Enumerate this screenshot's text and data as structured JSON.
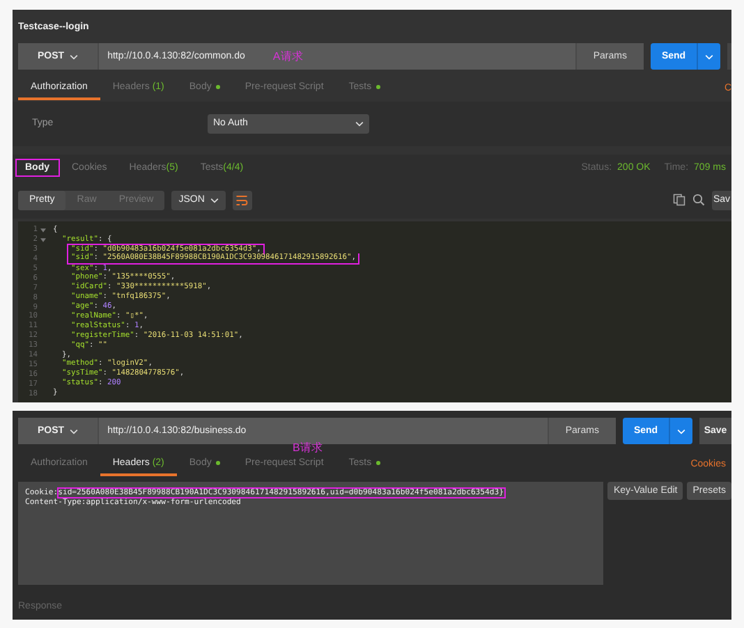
{
  "request_a": {
    "title": "Testcase--login",
    "method": "POST",
    "url": "http://10.0.4.130:82/common.do",
    "note": "A请求",
    "params_button": "Params",
    "send_button": "Send",
    "cookies_link": "C",
    "tabs": [
      {
        "label": "Authorization",
        "selected": true
      },
      {
        "label": "Headers",
        "count": "(1)",
        "selected": false
      },
      {
        "label": "Body",
        "dot": true,
        "selected": false
      },
      {
        "label": "Pre-request Script",
        "selected": false
      },
      {
        "label": "Tests",
        "dot": true,
        "selected": false
      }
    ],
    "auth": {
      "label": "Type",
      "value": "No Auth"
    }
  },
  "response_a": {
    "tabs": [
      {
        "label": "Body",
        "selected": true,
        "highlighted": true
      },
      {
        "label": "Cookies",
        "selected": false,
        "highlighted": false
      },
      {
        "label": "Headers",
        "count": "(5)",
        "selected": false,
        "highlighted": false
      },
      {
        "label": "Tests",
        "count": "(4/4)",
        "selected": false,
        "highlighted": false
      }
    ],
    "status_label": "Status:",
    "status": "200 OK",
    "time_label": "Time:",
    "time": "709 ms",
    "views": [
      {
        "label": "Pretty",
        "selected": true
      },
      {
        "label": "Raw",
        "selected": false
      },
      {
        "label": "Preview",
        "selected": false
      }
    ],
    "format": "JSON",
    "save_button": "Sav",
    "lines": [
      {
        "number": "1",
        "text": "{",
        "foldable": true,
        "highlighted": false
      },
      {
        "number": "2",
        "text": "  \"result\": {",
        "foldable": true,
        "highlighted": false
      },
      {
        "number": "3",
        "text": "    \"sid\": \"d0b90483a16b024f5e081a2dbc6354d3\",",
        "foldable": false,
        "highlighted": true
      },
      {
        "number": "4",
        "text": "    \"sid\": \"2560A080E38B45F89988CB190A1DC3C9309846171482915892616\",",
        "foldable": false,
        "highlighted": true
      },
      {
        "number": "5",
        "text": "    \"sex\": 1,",
        "foldable": false,
        "highlighted": false
      },
      {
        "number": "6",
        "text": "    \"phone\": \"135****0555\",",
        "foldable": false,
        "highlighted": false
      },
      {
        "number": "7",
        "text": "    \"idCard\": \"330***********5918\",",
        "foldable": false,
        "highlighted": false
      },
      {
        "number": "8",
        "text": "    \"uname\": \"tnfq186375\",",
        "foldable": false,
        "highlighted": false
      },
      {
        "number": "9",
        "text": "    \"age\": 46,",
        "foldable": false,
        "highlighted": false
      },
      {
        "number": "10",
        "text": "    \"realName\": \"▯*\",",
        "foldable": false,
        "highlighted": false
      },
      {
        "number": "11",
        "text": "    \"realStatus\": 1,",
        "foldable": false,
        "highlighted": false
      },
      {
        "number": "12",
        "text": "    \"registerTime\": \"2016-11-03 14:51:01\",",
        "foldable": false,
        "highlighted": false
      },
      {
        "number": "13",
        "text": "    \"qq\": \"\"",
        "foldable": false,
        "highlighted": false
      },
      {
        "number": "14",
        "text": "  },",
        "foldable": false,
        "highlighted": false
      },
      {
        "number": "15",
        "text": "  \"method\": \"loginV2\",",
        "foldable": false,
        "highlighted": false
      },
      {
        "number": "16",
        "text": "  \"sysTime\": \"1482804778576\",",
        "foldable": false,
        "highlighted": false
      },
      {
        "number": "17",
        "text": "  \"status\": 200",
        "foldable": false,
        "highlighted": false
      },
      {
        "number": "18",
        "text": "}",
        "foldable": false,
        "highlighted": false
      }
    ]
  },
  "request_b": {
    "method": "POST",
    "url": "http://10.0.4.130:82/business.do",
    "note": "B请求",
    "params_button": "Params",
    "send_button": "Send",
    "save_button": "Save",
    "cookies_link": "Cookies",
    "tabs": [
      {
        "label": "Authorization",
        "selected": false
      },
      {
        "label": "Headers",
        "count": "(2)",
        "selected": true
      },
      {
        "label": "Body",
        "dot": true,
        "selected": false
      },
      {
        "label": "Pre-request Script",
        "selected": false
      },
      {
        "label": "Tests",
        "dot": true,
        "selected": false
      }
    ],
    "header_lines": [
      {
        "prefix": "Cookie:",
        "text": "sid=2560A080E38B45F89988CB190A1DC3C9309846171482915892616,uid=d0b90483a16b024f5e081a2dbc6354d3}",
        "highlighted": true
      },
      {
        "prefix": "Content-Type:",
        "text": "application/x-www-form-urlencoded",
        "highlighted": false
      }
    ],
    "key_value_button": "Key-Value Edit",
    "presets_button": "Presets"
  },
  "response_b": {
    "label": "Response"
  }
}
